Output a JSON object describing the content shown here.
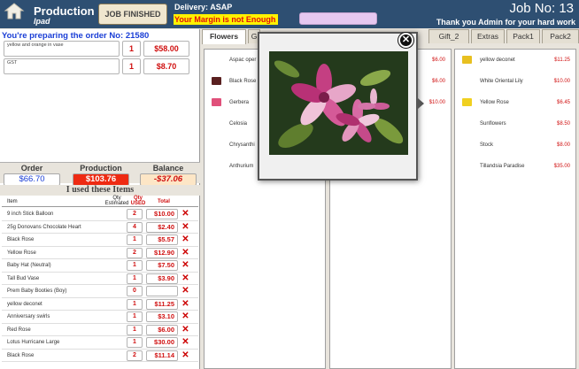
{
  "header": {
    "title": "Production",
    "subtitle": "Ipad",
    "finish_label": "JOB FINISHED",
    "delivery": "Delivery: ASAP",
    "margin_warning": "Your Margin is not Enough",
    "job_no": "Job No: 13",
    "thanks": "Thank you Admin for your hard work",
    "home_icon": "home-icon"
  },
  "order": {
    "preparing": "You're preparing the order No: 21580",
    "lines": [
      {
        "desc": "yellow and orange in vase",
        "qty": "1",
        "price": "$58.00"
      },
      {
        "desc": "GST",
        "qty": "1",
        "price": "$8.70"
      }
    ]
  },
  "totals": {
    "order_label": "Order",
    "order_value": "$66.70",
    "production_label": "Production",
    "production_value": "$103.76",
    "balance_label": "Balance",
    "balance_value": "-$37.06"
  },
  "used": {
    "title": "I used these Items",
    "col_item": "Item",
    "col_qty_est": "Qty Estimated",
    "col_qty_used": "Qty USED",
    "col_total": "Total",
    "rows": [
      {
        "name": "9 inch Stick Balloon",
        "qty": "2",
        "total": "$10.00"
      },
      {
        "name": "25g Donovans Chocolate Heart",
        "qty": "4",
        "total": "$2.40"
      },
      {
        "name": "Black Rose",
        "qty": "1",
        "total": "$5.57"
      },
      {
        "name": "Yellow Rose",
        "qty": "2",
        "total": "$12.90"
      },
      {
        "name": "Baby Hat (Neutral)",
        "qty": "1",
        "total": "$7.50"
      },
      {
        "name": "Tall Bud Vase",
        "qty": "1",
        "total": "$3.90"
      },
      {
        "name": "Prem Baby Booties (Boy)",
        "qty": "0",
        "total": ""
      },
      {
        "name": "yellow deconet",
        "qty": "1",
        "total": "$11.25"
      },
      {
        "name": "Anniversary swirls",
        "qty": "1",
        "total": "$3.10"
      },
      {
        "name": "Red Rose",
        "qty": "1",
        "total": "$6.00"
      },
      {
        "name": "Lotus Hurricane Large",
        "qty": "1",
        "total": "$30.00"
      },
      {
        "name": "Black Rose",
        "qty": "2",
        "total": "$11.14"
      }
    ]
  },
  "tabs": [
    {
      "label": "Flowers",
      "active": true
    },
    {
      "label": "G",
      "active": false
    },
    {
      "label": "Gift_2",
      "active": false
    },
    {
      "label": "Extras",
      "active": false
    },
    {
      "label": "Pack1",
      "active": false
    },
    {
      "label": "Pack2",
      "active": false
    }
  ],
  "columns": {
    "col1": [
      {
        "name": "Aspac oper",
        "price": "",
        "icon": ""
      },
      {
        "name": "Black Rose",
        "price": "",
        "icon": "black-rose"
      },
      {
        "name": "Gerbera",
        "price": "",
        "icon": "gerbera"
      },
      {
        "name": "Celosia",
        "price": "",
        "icon": ""
      },
      {
        "name": "Chrysanthi",
        "price": "",
        "icon": ""
      },
      {
        "name": "Anthurium",
        "price": "",
        "icon": ""
      }
    ],
    "col2": [
      {
        "name": "",
        "price": "$6.00",
        "icon": ""
      },
      {
        "name": "",
        "price": "$6.00",
        "icon": ""
      },
      {
        "name": "",
        "price": "$10.00",
        "icon": ""
      }
    ],
    "col3": [
      {
        "name": "yellow deconet",
        "price": "$11.25",
        "icon": "yellow-deconet"
      },
      {
        "name": "White Oriental Lily",
        "price": "$10.00",
        "icon": ""
      },
      {
        "name": "Yellow Rose",
        "price": "$6.45",
        "icon": "yellow-rose"
      },
      {
        "name": "Sunflowers",
        "price": "$8.50",
        "icon": ""
      },
      {
        "name": "Stock",
        "price": "$8.00",
        "icon": ""
      },
      {
        "name": "Tillandsia Paradise",
        "price": "$35.00",
        "icon": ""
      }
    ]
  },
  "popup": {
    "close_icon": "close-icon"
  },
  "colors": {
    "header_bg": "#2e4f72",
    "accent_red": "#d01010",
    "accent_blue": "#1a3ed6",
    "warning_yellow": "#fff200"
  }
}
